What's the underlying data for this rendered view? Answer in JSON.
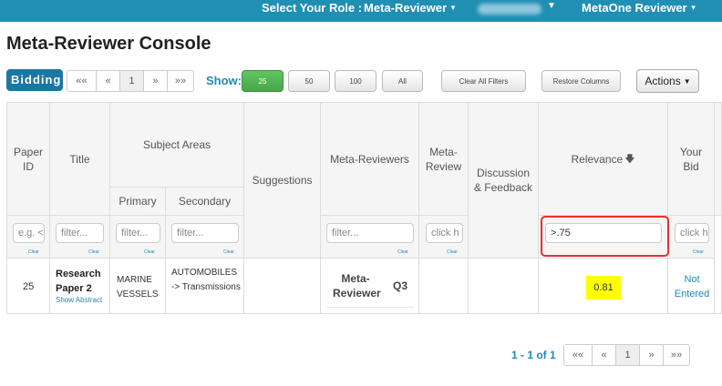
{
  "topbar": {
    "role_label": "Select Your Role :",
    "role_value": "Meta-Reviewer",
    "user_value": "MetaOne Reviewer"
  },
  "page_title": "Meta-Reviewer Console",
  "toolbar": {
    "tab_label": "Bidding",
    "pager": {
      "first": "««",
      "prev": "«",
      "page": "1",
      "next": "»",
      "last": "»»"
    },
    "show_label": "Show:",
    "show_options": [
      "25",
      "50",
      "100",
      "All"
    ],
    "clear_filters": "Clear All Filters",
    "restore_columns": "Restore Columns",
    "actions": "Actions"
  },
  "columns": {
    "paper_id": "Paper ID",
    "title": "Title",
    "subject_areas": "Subject Areas",
    "primary": "Primary",
    "secondary": "Secondary",
    "suggestions": "Suggestions",
    "meta_reviewers": "Meta-Reviewers",
    "meta_review": "Meta-Review",
    "discussion": "Discussion & Feedback",
    "relevance": "Relevance",
    "your_bid": "Your Bid"
  },
  "filters": {
    "paper_id_placeholder": "e.g. <",
    "title_placeholder": "filter...",
    "primary_placeholder": "filter...",
    "secondary_placeholder": "filter...",
    "meta_reviewers_placeholder": "filter...",
    "meta_review_placeholder": "click h",
    "relevance_value": ">.75",
    "your_bid_placeholder": "click h",
    "clear": "Clear"
  },
  "rows": [
    {
      "paper_id": "25",
      "title": "Research Paper 2",
      "show_abstract": "Show Abstract",
      "primary": "MARINE VESSELS",
      "secondary": "AUTOMOBILES -> Transmissions",
      "meta_reviewer": "Meta-Reviewer",
      "meta_reviewer_rank": "Q3",
      "relevance": "0.81",
      "your_bid": "Not Entered"
    }
  ],
  "footer": {
    "range": "1 - 1 of 1",
    "pager": {
      "first": "««",
      "prev": "«",
      "page": "1",
      "next": "»",
      "last": "»»"
    }
  },
  "colors": {
    "topbar": "#1f8fb4",
    "accent": "#1e8bb3",
    "highlight": "#ffff00",
    "filter_outline": "#e53030",
    "green": "#5cb85c"
  }
}
